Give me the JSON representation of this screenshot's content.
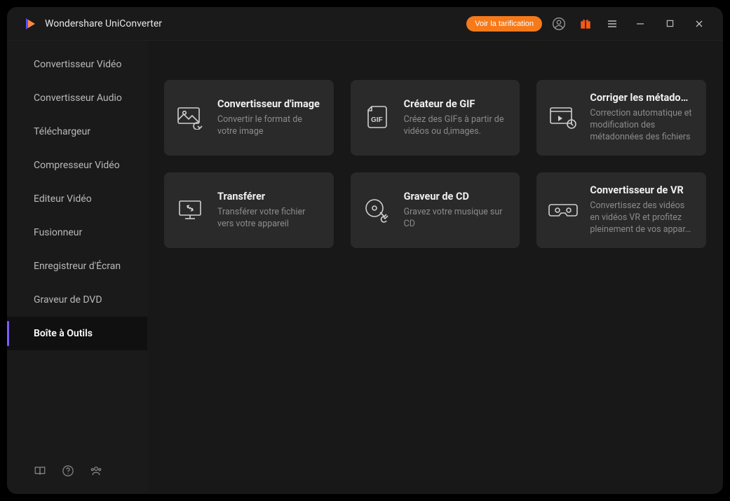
{
  "header": {
    "app_title": "Wondershare UniConverter",
    "pricing_label": "Voir la tarification"
  },
  "sidebar": {
    "items": [
      {
        "label": "Convertisseur Vidéo",
        "selected": false
      },
      {
        "label": "Convertisseur Audio",
        "selected": false
      },
      {
        "label": "Téléchargeur",
        "selected": false
      },
      {
        "label": "Compresseur Vidéo",
        "selected": false
      },
      {
        "label": "Editeur Vidéo",
        "selected": false
      },
      {
        "label": "Fusionneur",
        "selected": false
      },
      {
        "label": "Enregistreur d'Écran",
        "selected": false
      },
      {
        "label": "Graveur de DVD",
        "selected": false
      },
      {
        "label": "Boîte à Outils",
        "selected": true
      }
    ]
  },
  "toolbox": {
    "cards": [
      {
        "title": "Convertisseur d'image",
        "desc": "Convertir le format de votre image"
      },
      {
        "title": "Créateur de GIF",
        "desc": "Créez des GIFs à partir de vidéos ou d,images."
      },
      {
        "title": "Corriger les métado…",
        "desc": "Correction automatique et modification des métadonnées des fichiers"
      },
      {
        "title": "Transférer",
        "desc": "Transférer votre fichier vers votre appareil"
      },
      {
        "title": "Graveur de CD",
        "desc": "Gravez votre musique sur CD"
      },
      {
        "title": "Convertisseur de VR",
        "desc": "Convertissez des vidéos en vidéos VR et profitez pleinement de vos appar…"
      }
    ]
  },
  "colors": {
    "accent_orange": "#f67a1a",
    "accent_purple": "#7c5cff"
  }
}
